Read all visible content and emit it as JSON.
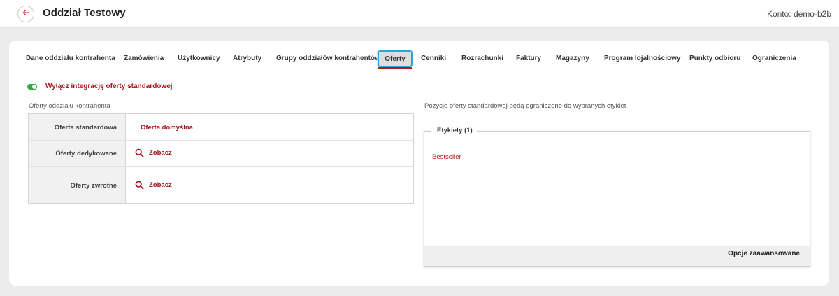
{
  "header": {
    "title": "Oddział Testowy",
    "account": "Konto: demo-b2b",
    "back_icon": "arrow-left-icon"
  },
  "tabs": [
    {
      "label": "Dane oddziału kontrahenta",
      "active": false
    },
    {
      "label": "Zamówienia",
      "active": false
    },
    {
      "label": "Użytkownicy",
      "active": false
    },
    {
      "label": "Atrybuty",
      "active": false
    },
    {
      "label": "Grupy oddziałów kontrahentów",
      "active": false
    },
    {
      "label": "Oferty",
      "active": true
    },
    {
      "label": "Cenniki",
      "active": false
    },
    {
      "label": "Rozrachunki",
      "active": false
    },
    {
      "label": "Faktury",
      "active": false
    },
    {
      "label": "Magazyny",
      "active": false
    },
    {
      "label": "Program lojalnościowy",
      "active": false
    },
    {
      "label": "Punkty odbioru",
      "active": false
    },
    {
      "label": "Ograniczenia",
      "active": false
    }
  ],
  "integration_toggle": {
    "label": "Wyłącz integrację oferty standardowej",
    "on": true
  },
  "offers_section": {
    "title": "Oferty oddziału kontrahenta",
    "rows": [
      {
        "label": "Oferta standardowa",
        "value": "Oferta domyślna",
        "icon": null
      },
      {
        "label": "Oferty dedykowane",
        "value": "Zobacz",
        "icon": "search-icon"
      },
      {
        "label": "Oferty zwrotne",
        "value": "Zobacz",
        "icon": "search-icon"
      }
    ]
  },
  "tags_section": {
    "note": "Pozycje oferty standardowej będą ograniczone do wybranych etykiet",
    "legend": "Etykiety (1)",
    "items": [
      "Bestseller"
    ],
    "advanced_options": "Opcje zaawansowane"
  },
  "colors": {
    "accent": "#a4151c",
    "toggle_on": "#3aa649",
    "active_tab_border": "#2aa7d6"
  }
}
